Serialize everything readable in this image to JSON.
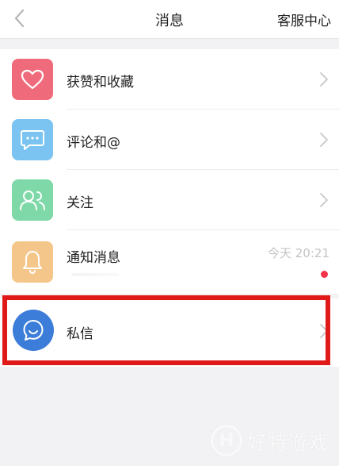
{
  "header": {
    "title": "消息",
    "right_label": "客服中心"
  },
  "items": [
    {
      "label": "获赞和收藏",
      "icon": "heart-icon",
      "color": "#ef6b7b"
    },
    {
      "label": "评论和@",
      "icon": "chat-bubble-icon",
      "color": "#7bc4f1"
    },
    {
      "label": "关注",
      "icon": "users-icon",
      "color": "#7fd8a7"
    },
    {
      "label": "通知消息",
      "icon": "bell-icon",
      "color": "#f5c68a",
      "time": "今天 20:21",
      "unread": true
    }
  ],
  "private_message": {
    "label": "私信",
    "icon": "message-icon",
    "color": "#3b7dd8",
    "highlight_color": "#e01919"
  },
  "watermark": {
    "logo": "H",
    "text": "好特游戏"
  }
}
